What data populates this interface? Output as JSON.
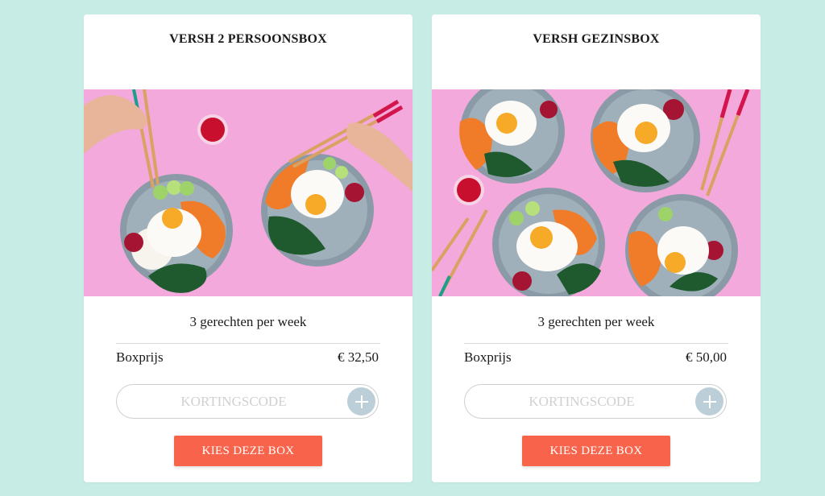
{
  "cards": [
    {
      "title": "VERSH 2 PERSOONSBOX",
      "image_alt": "Twee bibimbap-bowls met gebakken ei op roze achtergrond",
      "meals": "3 gerechten per week",
      "price_label": "Boxprijs",
      "price": "€ 32,50",
      "coupon_placeholder": "KORTINGSCODE",
      "button_label": "KIES DEZE BOX"
    },
    {
      "title": "VERSH GEZINSBOX",
      "image_alt": "Vier bibimbap-bowls met gebakken ei op roze achtergrond",
      "meals": "3 gerechten per week",
      "price_label": "Boxprijs",
      "price": "€ 50,00",
      "coupon_placeholder": "KORTINGSCODE",
      "button_label": "KIES DEZE BOX"
    }
  ],
  "colors": {
    "page_background": "#c6ece5",
    "card_background": "#ffffff",
    "button": "#f8644b",
    "add_button": "#bccfd8",
    "image_background": "#f4a9dc"
  },
  "icons": {
    "coupon_add": "plus-icon"
  }
}
